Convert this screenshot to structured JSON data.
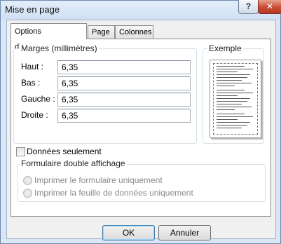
{
  "window": {
    "title": "Mise en page",
    "help_label": "?",
    "close_label": "✕"
  },
  "tabs": [
    {
      "label": "Options d'impression",
      "active": true
    },
    {
      "label": "Page",
      "active": false
    },
    {
      "label": "Colonnes",
      "active": false
    }
  ],
  "margins": {
    "legend": "Marges (millimètres)",
    "fields": [
      {
        "label": "Haut :",
        "value": "6,35"
      },
      {
        "label": "Bas :",
        "value": "6,35"
      },
      {
        "label": "Gauche :",
        "value": "6,35"
      },
      {
        "label": "Droite :",
        "value": "6,35"
      }
    ]
  },
  "example": {
    "legend": "Exemple"
  },
  "data_only": {
    "label": "Données seulement",
    "checked": false
  },
  "split_form": {
    "legend": "Formulaire double affichage",
    "options": [
      {
        "label": "Imprimer le formulaire uniquement",
        "enabled": false
      },
      {
        "label": "Imprimer la feuille de données uniquement",
        "enabled": false
      }
    ]
  },
  "buttons": {
    "ok": "OK",
    "cancel": "Annuler"
  }
}
